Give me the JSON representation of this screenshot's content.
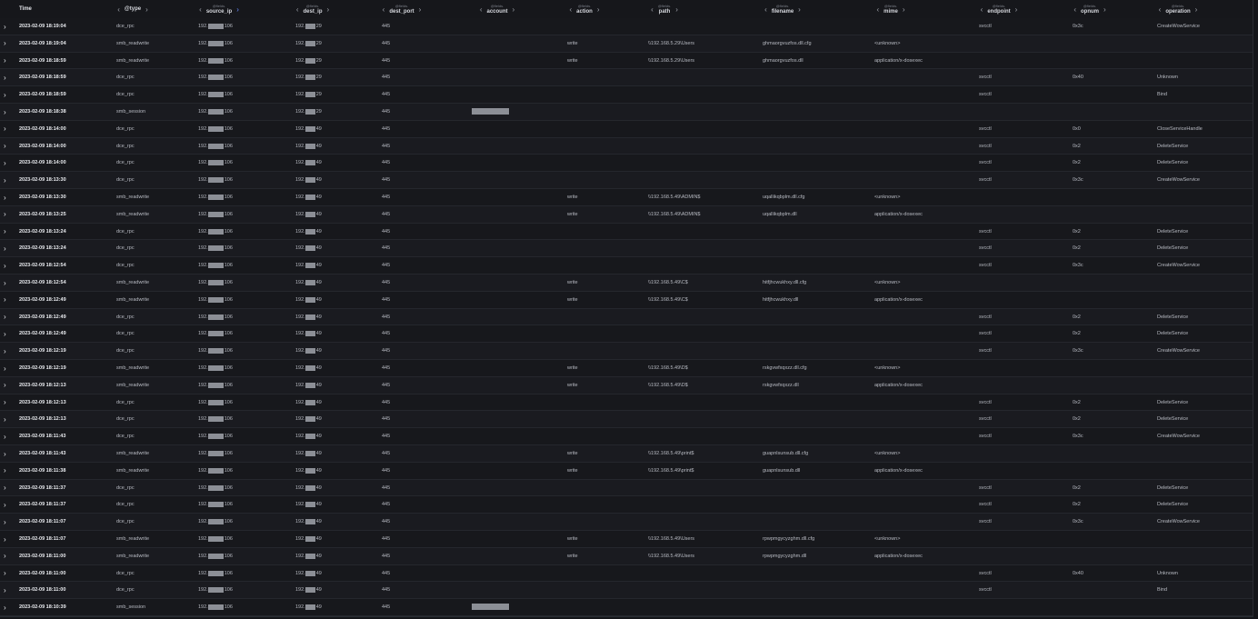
{
  "header": {
    "time_label": "Time",
    "columns": [
      {
        "key": "type",
        "prefix": "",
        "label": "@type"
      },
      {
        "key": "source_ip",
        "prefix": "@fields.",
        "label": "source_ip"
      },
      {
        "key": "dest_ip",
        "prefix": "@fields.",
        "label": "dest_ip"
      },
      {
        "key": "dest_port",
        "prefix": "@fields.",
        "label": "dest_port"
      },
      {
        "key": "account",
        "prefix": "@fields.",
        "label": "account"
      },
      {
        "key": "action",
        "prefix": "@fields.",
        "label": "action"
      },
      {
        "key": "path",
        "prefix": "@fields.",
        "label": "path"
      },
      {
        "key": "filename",
        "prefix": "@fields.",
        "label": "filename"
      },
      {
        "key": "mime",
        "prefix": "@fields.",
        "label": "mime"
      },
      {
        "key": "endpoint",
        "prefix": "@fields.",
        "label": "endpoint"
      },
      {
        "key": "opnum",
        "prefix": "@fields.",
        "label": "opnum"
      },
      {
        "key": "operation",
        "prefix": "@fields.",
        "label": "operation"
      }
    ]
  },
  "icons": {
    "expand": "chevron-right-icon",
    "left_arrow": "chevron-left-icon",
    "right_arrow": "chevron-right-icon"
  },
  "colors": {
    "background": "#16171b",
    "accent_arrow": "#6a8cff"
  },
  "rows": [
    {
      "time": "2023-02-09 18:19:04",
      "type": "dce_rpc",
      "src_pre": "192.",
      "src_suf": "106",
      "dst_pre": "192.",
      "dst_suf": "29",
      "port": "445",
      "account_redacted": false,
      "action": "",
      "path": "",
      "filename": "",
      "mime": "",
      "endpoint": "svcctl",
      "opnum": "0x3c",
      "operation": "CreateWowService"
    },
    {
      "time": "2023-02-09 18:19:04",
      "type": "smb_readwrite",
      "src_pre": "192.",
      "src_suf": "106",
      "dst_pre": "192.",
      "dst_suf": "29",
      "port": "445",
      "account_redacted": false,
      "action": "write",
      "path": "\\\\192.168.5.29\\Users",
      "filename": "ghmaorgvuzfos.dll.cfg",
      "mime": "<unknown>",
      "endpoint": "",
      "opnum": "",
      "operation": ""
    },
    {
      "time": "2023-02-09 18:18:59",
      "type": "smb_readwrite",
      "src_pre": "192.",
      "src_suf": "106",
      "dst_pre": "192.",
      "dst_suf": "29",
      "port": "445",
      "account_redacted": false,
      "action": "write",
      "path": "\\\\192.168.5.29\\Users",
      "filename": "ghmaorgvuzfos.dll",
      "mime": "application/x-dosexec",
      "endpoint": "",
      "opnum": "",
      "operation": ""
    },
    {
      "time": "2023-02-09 18:18:59",
      "type": "dce_rpc",
      "src_pre": "192.",
      "src_suf": "106",
      "dst_pre": "192.",
      "dst_suf": "29",
      "port": "445",
      "account_redacted": false,
      "action": "",
      "path": "",
      "filename": "",
      "mime": "",
      "endpoint": "svcctl",
      "opnum": "0x40",
      "operation": "Unknown"
    },
    {
      "time": "2023-02-09 18:18:59",
      "type": "dce_rpc",
      "src_pre": "192.",
      "src_suf": "106",
      "dst_pre": "192.",
      "dst_suf": "29",
      "port": "445",
      "account_redacted": false,
      "action": "",
      "path": "",
      "filename": "",
      "mime": "",
      "endpoint": "svcctl",
      "opnum": "",
      "operation": "Bind"
    },
    {
      "time": "2023-02-09 18:18:38",
      "type": "smb_session",
      "src_pre": "192.",
      "src_suf": "106",
      "dst_pre": "192.",
      "dst_suf": "29",
      "port": "445",
      "account_redacted": true,
      "action": "",
      "path": "",
      "filename": "",
      "mime": "",
      "endpoint": "",
      "opnum": "",
      "operation": ""
    },
    {
      "time": "2023-02-09 18:14:00",
      "type": "dce_rpc",
      "src_pre": "192.",
      "src_suf": "106",
      "dst_pre": "192.",
      "dst_suf": "49",
      "port": "445",
      "account_redacted": false,
      "action": "",
      "path": "",
      "filename": "",
      "mime": "",
      "endpoint": "svcctl",
      "opnum": "0x0",
      "operation": "CloseServiceHandle"
    },
    {
      "time": "2023-02-09 18:14:00",
      "type": "dce_rpc",
      "src_pre": "192.",
      "src_suf": "106",
      "dst_pre": "192.",
      "dst_suf": "49",
      "port": "445",
      "account_redacted": false,
      "action": "",
      "path": "",
      "filename": "",
      "mime": "",
      "endpoint": "svcctl",
      "opnum": "0x2",
      "operation": "DeleteService"
    },
    {
      "time": "2023-02-09 18:14:00",
      "type": "dce_rpc",
      "src_pre": "192.",
      "src_suf": "106",
      "dst_pre": "192.",
      "dst_suf": "49",
      "port": "445",
      "account_redacted": false,
      "action": "",
      "path": "",
      "filename": "",
      "mime": "",
      "endpoint": "svcctl",
      "opnum": "0x2",
      "operation": "DeleteService"
    },
    {
      "time": "2023-02-09 18:13:30",
      "type": "dce_rpc",
      "src_pre": "192.",
      "src_suf": "106",
      "dst_pre": "192.",
      "dst_suf": "49",
      "port": "445",
      "account_redacted": false,
      "action": "",
      "path": "",
      "filename": "",
      "mime": "",
      "endpoint": "svcctl",
      "opnum": "0x3c",
      "operation": "CreateWowService"
    },
    {
      "time": "2023-02-09 18:13:30",
      "type": "smb_readwrite",
      "src_pre": "192.",
      "src_suf": "106",
      "dst_pre": "192.",
      "dst_suf": "49",
      "port": "445",
      "account_redacted": false,
      "action": "write",
      "path": "\\\\192.168.5.49\\ADMIN$",
      "filename": "uqallikqbplm.dll.cfg",
      "mime": "<unknown>",
      "endpoint": "",
      "opnum": "",
      "operation": ""
    },
    {
      "time": "2023-02-09 18:13:25",
      "type": "smb_readwrite",
      "src_pre": "192.",
      "src_suf": "106",
      "dst_pre": "192.",
      "dst_suf": "49",
      "port": "445",
      "account_redacted": false,
      "action": "write",
      "path": "\\\\192.168.5.49\\ADMIN$",
      "filename": "uqallikqbplm.dll",
      "mime": "application/x-dosexec",
      "endpoint": "",
      "opnum": "",
      "operation": ""
    },
    {
      "time": "2023-02-09 18:13:24",
      "type": "dce_rpc",
      "src_pre": "192.",
      "src_suf": "106",
      "dst_pre": "192.",
      "dst_suf": "49",
      "port": "445",
      "account_redacted": false,
      "action": "",
      "path": "",
      "filename": "",
      "mime": "",
      "endpoint": "svcctl",
      "opnum": "0x2",
      "operation": "DeleteService"
    },
    {
      "time": "2023-02-09 18:13:24",
      "type": "dce_rpc",
      "src_pre": "192.",
      "src_suf": "106",
      "dst_pre": "192.",
      "dst_suf": "49",
      "port": "445",
      "account_redacted": false,
      "action": "",
      "path": "",
      "filename": "",
      "mime": "",
      "endpoint": "svcctl",
      "opnum": "0x2",
      "operation": "DeleteService"
    },
    {
      "time": "2023-02-09 18:12:54",
      "type": "dce_rpc",
      "src_pre": "192.",
      "src_suf": "106",
      "dst_pre": "192.",
      "dst_suf": "49",
      "port": "445",
      "account_redacted": false,
      "action": "",
      "path": "",
      "filename": "",
      "mime": "",
      "endpoint": "svcctl",
      "opnum": "0x3c",
      "operation": "CreateWowService"
    },
    {
      "time": "2023-02-09 18:12:54",
      "type": "smb_readwrite",
      "src_pre": "192.",
      "src_suf": "106",
      "dst_pre": "192.",
      "dst_suf": "49",
      "port": "445",
      "account_redacted": false,
      "action": "write",
      "path": "\\\\192.168.5.49\\C$",
      "filename": "hitfjhcwukhxy.dll.cfg",
      "mime": "<unknown>",
      "endpoint": "",
      "opnum": "",
      "operation": ""
    },
    {
      "time": "2023-02-09 18:12:49",
      "type": "smb_readwrite",
      "src_pre": "192.",
      "src_suf": "106",
      "dst_pre": "192.",
      "dst_suf": "49",
      "port": "445",
      "account_redacted": false,
      "action": "write",
      "path": "\\\\192.168.5.49\\C$",
      "filename": "hitfjhcwukhxy.dll",
      "mime": "application/x-dosexec",
      "endpoint": "",
      "opnum": "",
      "operation": ""
    },
    {
      "time": "2023-02-09 18:12:49",
      "type": "dce_rpc",
      "src_pre": "192.",
      "src_suf": "106",
      "dst_pre": "192.",
      "dst_suf": "49",
      "port": "445",
      "account_redacted": false,
      "action": "",
      "path": "",
      "filename": "",
      "mime": "",
      "endpoint": "svcctl",
      "opnum": "0x2",
      "operation": "DeleteService"
    },
    {
      "time": "2023-02-09 18:12:49",
      "type": "dce_rpc",
      "src_pre": "192.",
      "src_suf": "106",
      "dst_pre": "192.",
      "dst_suf": "49",
      "port": "445",
      "account_redacted": false,
      "action": "",
      "path": "",
      "filename": "",
      "mime": "",
      "endpoint": "svcctl",
      "opnum": "0x2",
      "operation": "DeleteService"
    },
    {
      "time": "2023-02-09 18:12:19",
      "type": "dce_rpc",
      "src_pre": "192.",
      "src_suf": "106",
      "dst_pre": "192.",
      "dst_suf": "49",
      "port": "445",
      "account_redacted": false,
      "action": "",
      "path": "",
      "filename": "",
      "mime": "",
      "endpoint": "svcctl",
      "opnum": "0x3c",
      "operation": "CreateWowService"
    },
    {
      "time": "2023-02-09 18:12:19",
      "type": "smb_readwrite",
      "src_pre": "192.",
      "src_suf": "106",
      "dst_pre": "192.",
      "dst_suf": "49",
      "port": "445",
      "account_redacted": false,
      "action": "write",
      "path": "\\\\192.168.5.49\\D$",
      "filename": "rskgvwfxqxzz.dll.cfg",
      "mime": "<unknown>",
      "endpoint": "",
      "opnum": "",
      "operation": ""
    },
    {
      "time": "2023-02-09 18:12:13",
      "type": "smb_readwrite",
      "src_pre": "192.",
      "src_suf": "106",
      "dst_pre": "192.",
      "dst_suf": "49",
      "port": "445",
      "account_redacted": false,
      "action": "write",
      "path": "\\\\192.168.5.49\\D$",
      "filename": "rskgvwfxqxzz.dll",
      "mime": "application/x-dosexec",
      "endpoint": "",
      "opnum": "",
      "operation": ""
    },
    {
      "time": "2023-02-09 18:12:13",
      "type": "dce_rpc",
      "src_pre": "192.",
      "src_suf": "106",
      "dst_pre": "192.",
      "dst_suf": "49",
      "port": "445",
      "account_redacted": false,
      "action": "",
      "path": "",
      "filename": "",
      "mime": "",
      "endpoint": "svcctl",
      "opnum": "0x2",
      "operation": "DeleteService"
    },
    {
      "time": "2023-02-09 18:12:13",
      "type": "dce_rpc",
      "src_pre": "192.",
      "src_suf": "106",
      "dst_pre": "192.",
      "dst_suf": "49",
      "port": "445",
      "account_redacted": false,
      "action": "",
      "path": "",
      "filename": "",
      "mime": "",
      "endpoint": "svcctl",
      "opnum": "0x2",
      "operation": "DeleteService"
    },
    {
      "time": "2023-02-09 18:11:43",
      "type": "dce_rpc",
      "src_pre": "192.",
      "src_suf": "106",
      "dst_pre": "192.",
      "dst_suf": "49",
      "port": "445",
      "account_redacted": false,
      "action": "",
      "path": "",
      "filename": "",
      "mime": "",
      "endpoint": "svcctl",
      "opnum": "0x3c",
      "operation": "CreateWowService"
    },
    {
      "time": "2023-02-09 18:11:43",
      "type": "smb_readwrite",
      "src_pre": "192.",
      "src_suf": "106",
      "dst_pre": "192.",
      "dst_suf": "49",
      "port": "445",
      "account_redacted": false,
      "action": "write",
      "path": "\\\\192.168.5.49\\print$",
      "filename": "guapnlsunsub.dll.cfg",
      "mime": "<unknown>",
      "endpoint": "",
      "opnum": "",
      "operation": ""
    },
    {
      "time": "2023-02-09 18:11:38",
      "type": "smb_readwrite",
      "src_pre": "192.",
      "src_suf": "106",
      "dst_pre": "192.",
      "dst_suf": "49",
      "port": "445",
      "account_redacted": false,
      "action": "write",
      "path": "\\\\192.168.5.49\\print$",
      "filename": "guapnlsunsub.dll",
      "mime": "application/x-dosexec",
      "endpoint": "",
      "opnum": "",
      "operation": ""
    },
    {
      "time": "2023-02-09 18:11:37",
      "type": "dce_rpc",
      "src_pre": "192.",
      "src_suf": "106",
      "dst_pre": "192.",
      "dst_suf": "49",
      "port": "445",
      "account_redacted": false,
      "action": "",
      "path": "",
      "filename": "",
      "mime": "",
      "endpoint": "svcctl",
      "opnum": "0x2",
      "operation": "DeleteService"
    },
    {
      "time": "2023-02-09 18:11:37",
      "type": "dce_rpc",
      "src_pre": "192.",
      "src_suf": "106",
      "dst_pre": "192.",
      "dst_suf": "49",
      "port": "445",
      "account_redacted": false,
      "action": "",
      "path": "",
      "filename": "",
      "mime": "",
      "endpoint": "svcctl",
      "opnum": "0x2",
      "operation": "DeleteService"
    },
    {
      "time": "2023-02-09 18:11:07",
      "type": "dce_rpc",
      "src_pre": "192.",
      "src_suf": "106",
      "dst_pre": "192.",
      "dst_suf": "49",
      "port": "445",
      "account_redacted": false,
      "action": "",
      "path": "",
      "filename": "",
      "mime": "",
      "endpoint": "svcctl",
      "opnum": "0x3c",
      "operation": "CreateWowService"
    },
    {
      "time": "2023-02-09 18:11:07",
      "type": "smb_readwrite",
      "src_pre": "192.",
      "src_suf": "106",
      "dst_pre": "192.",
      "dst_suf": "49",
      "port": "445",
      "account_redacted": false,
      "action": "write",
      "path": "\\\\192.168.5.49\\Users",
      "filename": "rpwpmgycyzghm.dll.cfg",
      "mime": "<unknown>",
      "endpoint": "",
      "opnum": "",
      "operation": ""
    },
    {
      "time": "2023-02-09 18:11:00",
      "type": "smb_readwrite",
      "src_pre": "192.",
      "src_suf": "106",
      "dst_pre": "192.",
      "dst_suf": "49",
      "port": "445",
      "account_redacted": false,
      "action": "write",
      "path": "\\\\192.168.5.49\\Users",
      "filename": "rpwpmgycyzghm.dll",
      "mime": "application/x-dosexec",
      "endpoint": "",
      "opnum": "",
      "operation": ""
    },
    {
      "time": "2023-02-09 18:11:00",
      "type": "dce_rpc",
      "src_pre": "192.",
      "src_suf": "106",
      "dst_pre": "192.",
      "dst_suf": "49",
      "port": "445",
      "account_redacted": false,
      "action": "",
      "path": "",
      "filename": "",
      "mime": "",
      "endpoint": "svcctl",
      "opnum": "0x40",
      "operation": "Unknown"
    },
    {
      "time": "2023-02-09 18:11:00",
      "type": "dce_rpc",
      "src_pre": "192.",
      "src_suf": "106",
      "dst_pre": "192.",
      "dst_suf": "49",
      "port": "445",
      "account_redacted": false,
      "action": "",
      "path": "",
      "filename": "",
      "mime": "",
      "endpoint": "svcctl",
      "opnum": "",
      "operation": "Bind"
    },
    {
      "time": "2023-02-09 18:10:39",
      "type": "smb_session",
      "src_pre": "192.",
      "src_suf": "106",
      "dst_pre": "192.",
      "dst_suf": "49",
      "port": "445",
      "account_redacted": true,
      "action": "",
      "path": "",
      "filename": "",
      "mime": "",
      "endpoint": "",
      "opnum": "",
      "operation": ""
    }
  ]
}
